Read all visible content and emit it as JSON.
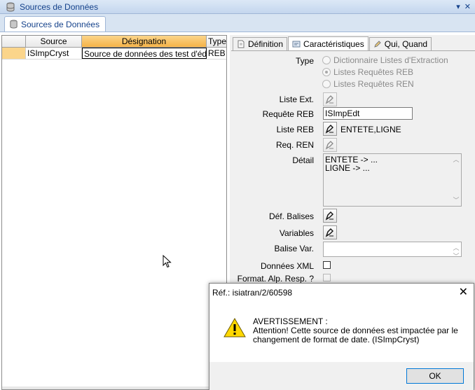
{
  "window": {
    "title": "Sources de Données",
    "controls": [
      "▾",
      "✕"
    ]
  },
  "doc_tab": {
    "label": "Sources de Données"
  },
  "grid": {
    "columns": [
      "",
      "Source",
      "Désignation",
      "Type"
    ],
    "rows": [
      {
        "indicator": "",
        "source": "ISImpCryst",
        "designation": "Source de données des test d'édition",
        "type": "REB"
      }
    ]
  },
  "panel": {
    "tabs": [
      "Définition",
      "Caractéristiques",
      "Qui, Quand"
    ],
    "active_tab": "Caractéristiques",
    "labels": {
      "type": "Type",
      "liste_ext": "Liste Ext.",
      "requete_reb": "Requête REB",
      "liste_reb": "Liste REB",
      "req_ren": "Req. REN",
      "detail": "Détail",
      "def_balises": "Déf. Balises",
      "variables": "Variables",
      "balise_var": "Balise Var.",
      "donnees_xml": "Données XML",
      "format_alp": "Format. Alp. Resp. ?"
    },
    "type_options": [
      "Dictionnaire Listes d'Extraction",
      "Listes Requêtes REB",
      "Listes Requêtes REN"
    ],
    "type_selected": "Listes Requêtes REB",
    "requete_reb_value": "ISImpEdt",
    "liste_reb_value": "ENTETE,LIGNE",
    "detail_lines": [
      "ENTETE -> ...",
      "LIGNE -> ..."
    ],
    "balise_var_value": "",
    "donnees_xml_checked": false,
    "format_alp_checked": false
  },
  "dialog": {
    "title": "Réf.: isiatran/2/60598",
    "close": "✕",
    "heading": "AVERTISSEMENT :",
    "message": "Attention! Cette source de données est impactée par le changement de format de date. (ISImpCryst)",
    "ok_label": "OK"
  },
  "colors": {
    "title_text": "#15428b",
    "selected_header": "#f5b247",
    "ok_border": "#0078d7",
    "warning_yellow": "#ffd800"
  }
}
